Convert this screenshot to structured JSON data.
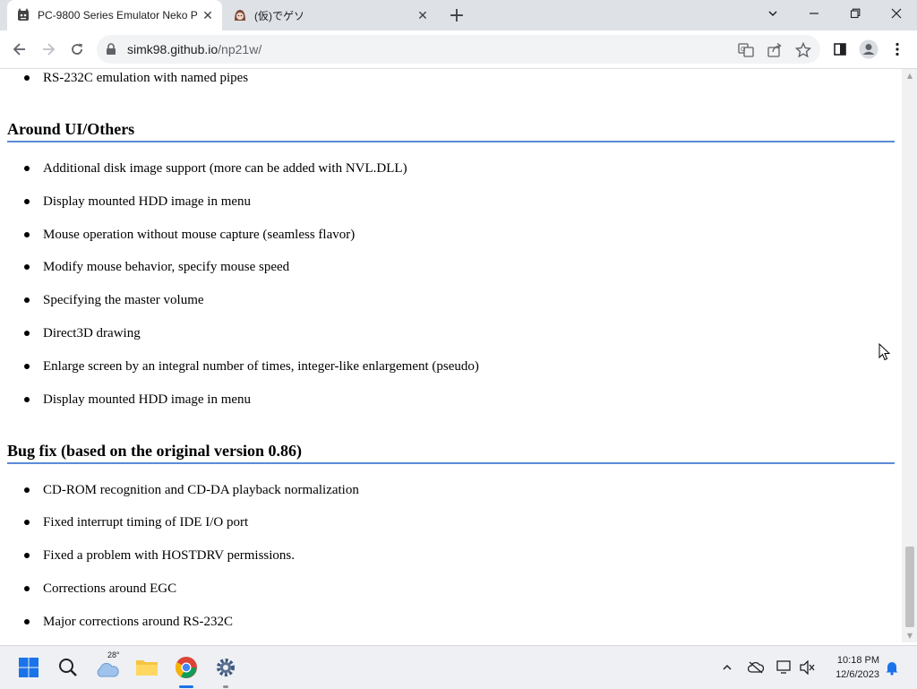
{
  "browser": {
    "tabs": [
      {
        "title": "PC-9800 Series Emulator Neko P",
        "icon": "neko-project-icon",
        "active": true
      },
      {
        "title": "(仮)でゲソ",
        "icon": "ika-musume-icon",
        "active": false
      }
    ],
    "url_host": "simk98.github.io",
    "url_path": "/np21w/"
  },
  "content": {
    "top_item": "RS-232C emulation with named pipes",
    "section1": {
      "heading": "Around UI/Others",
      "items": [
        "Additional disk image support (more can be added with NVL.DLL)",
        "Display mounted HDD image in menu",
        "Mouse operation without mouse capture (seamless flavor)",
        "Modify mouse behavior, specify mouse speed",
        "Specifying the master volume",
        "Direct3D drawing",
        "Enlarge screen by an integral number of times, integer-like enlargement (pseudo)",
        "Display mounted HDD image in menu"
      ]
    },
    "section2": {
      "heading": "Bug fix (based on the original version 0.86)",
      "items": [
        "CD-ROM recognition and CD-DA playback normalization",
        "Fixed interrupt timing of IDE I/O port",
        "Fixed a problem with HOSTDRV permissions.",
        "Corrections around EGC",
        "Major corrections around RS-232C"
      ]
    }
  },
  "taskbar": {
    "weather_temp": "28°",
    "time": "10:18 PM",
    "date": "12/6/2023"
  },
  "colors": {
    "heading_rule": "#5b8ad8",
    "tabstrip_bg": "#dee1e6",
    "taskbar_bg": "#eef0f4",
    "chrome_accent": "#1a73e8"
  }
}
